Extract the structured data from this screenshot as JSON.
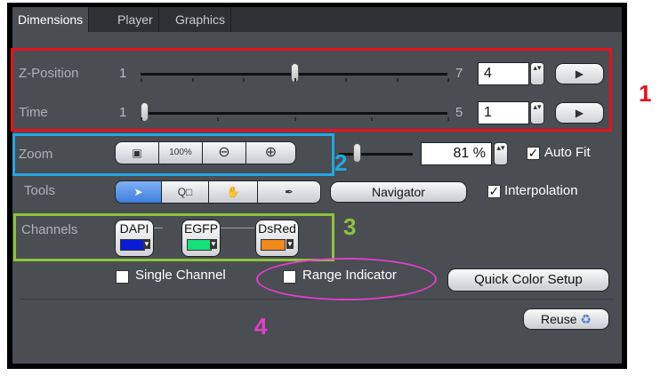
{
  "tabs": [
    {
      "label": "Dimensions",
      "active": true
    },
    {
      "label": "Player",
      "active": false
    },
    {
      "label": "Graphics",
      "active": false
    }
  ],
  "zposition": {
    "label": "Z-Position",
    "min": "1",
    "max": "7",
    "value": "4",
    "slider_fraction": 0.5,
    "play_icon": "▶"
  },
  "time": {
    "label": "Time",
    "min": "1",
    "max": "5",
    "value": "1",
    "slider_fraction": 0.0,
    "play_icon": "▶"
  },
  "zoom": {
    "label": "Zoom",
    "buttons": [
      {
        "name": "fit-to-window-icon",
        "glyph": "▣"
      },
      {
        "name": "zoom-100-button",
        "glyph": "100%"
      },
      {
        "name": "zoom-out-icon",
        "glyph": "⊖"
      },
      {
        "name": "zoom-in-icon",
        "glyph": "⊕"
      }
    ],
    "value": "81 %",
    "slider_fraction": 0.15,
    "auto_fit_label": "Auto Fit",
    "auto_fit_checked": true
  },
  "tools": {
    "label": "Tools",
    "buttons": [
      {
        "name": "pointer-tool-icon",
        "glyph": "➤",
        "active": true
      },
      {
        "name": "zoom-region-tool-icon",
        "glyph": "Q□",
        "active": false
      },
      {
        "name": "pan-hand-tool-icon",
        "glyph": "✋",
        "active": false
      },
      {
        "name": "eyedropper-tool-icon",
        "glyph": "✒",
        "active": false
      }
    ],
    "navigator_label": "Navigator",
    "interpolation_label": "Interpolation",
    "interpolation_checked": true
  },
  "channels": {
    "label": "Channels",
    "items": [
      {
        "name": "DAPI",
        "color": "#0a1bd6"
      },
      {
        "name": "EGFP",
        "color": "#16e07a"
      },
      {
        "name": "DsRed",
        "color": "#f08a1a"
      }
    ],
    "single_channel_label": "Single Channel",
    "range_indicator_label": "Range Indicator",
    "quick_color_label": "Quick Color Setup"
  },
  "reuse_label": "Reuse",
  "reuse_icon": "♻",
  "checkmark": "✓",
  "stepper_arrows": "▴▾",
  "annotations": [
    {
      "number": "1",
      "color": "#e8101c"
    },
    {
      "number": "2",
      "color": "#22a8e0"
    },
    {
      "number": "3",
      "color": "#8cc43c"
    },
    {
      "number": "4",
      "color": "#e040c8"
    }
  ]
}
